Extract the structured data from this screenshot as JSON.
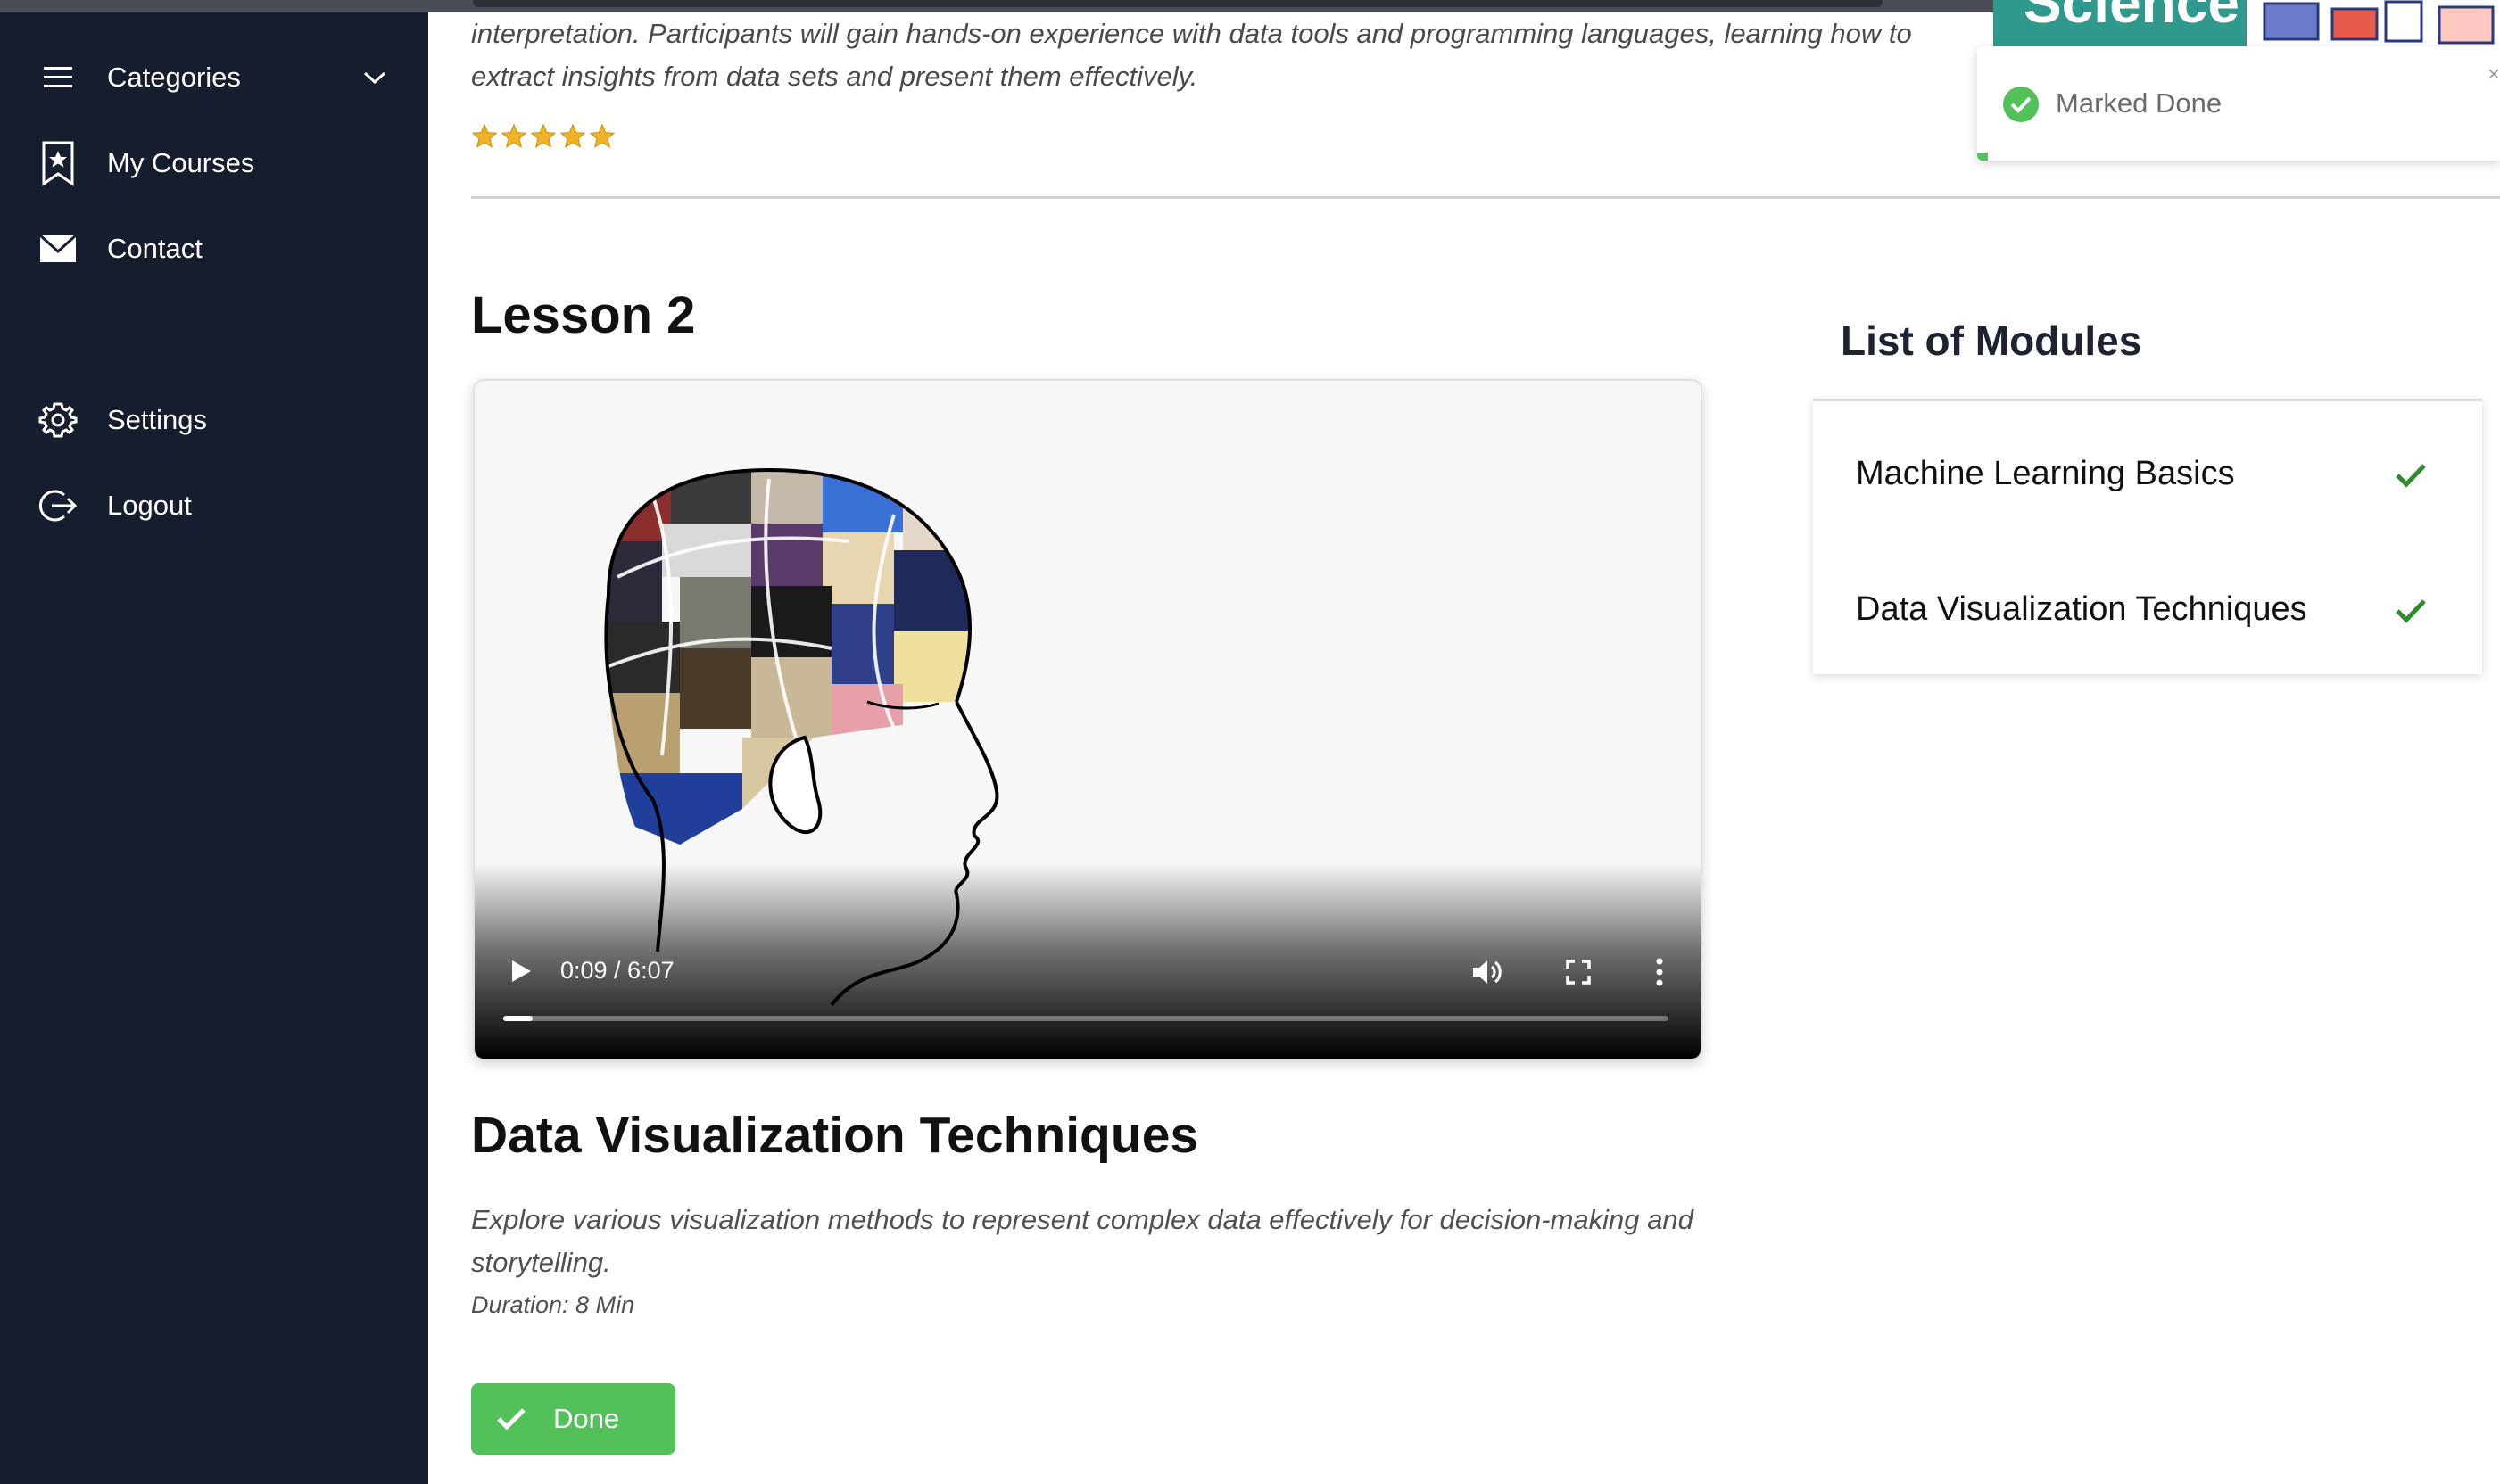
{
  "sidebar": {
    "items": [
      {
        "label": "Categories",
        "icon": "hamburger-icon",
        "expandable": true
      },
      {
        "label": "My Courses",
        "icon": "bookmark-star-icon"
      },
      {
        "label": "Contact",
        "icon": "mail-icon"
      },
      {
        "label": "Settings",
        "icon": "gear-icon"
      },
      {
        "label": "Logout",
        "icon": "logout-icon"
      }
    ]
  },
  "course": {
    "intro_text": "interpretation. Participants will gain hands-on experience with data tools and programming languages, learning how to extract insights from data sets and present them effectively.",
    "rating": 5,
    "rating_max": 5
  },
  "lesson": {
    "title": "Lesson 2",
    "video": {
      "current_time": "0:09",
      "duration": "6:07",
      "time_display": "0:09 / 6:07",
      "progress_fraction": 0.025
    },
    "module_title": "Data Visualization Techniques",
    "module_description": "Explore various visualization methods to represent complex data effectively for decision-making and storytelling.",
    "duration_text": "Duration: 8 Min",
    "done_button_label": "Done"
  },
  "modules_panel": {
    "title": "List of Modules",
    "items": [
      {
        "label": "Machine Learning Basics",
        "completed": true
      },
      {
        "label": "Data Visualization Techniques",
        "completed": true
      }
    ]
  },
  "banner": {
    "text": "Science"
  },
  "toast": {
    "message": "Marked Done",
    "progress_fraction": 0.02
  },
  "colors": {
    "sidebar_bg": "#161d2e",
    "accent_green": "#52c15a",
    "check_green": "#2e8b2e",
    "star_gold": "#f0b323"
  }
}
